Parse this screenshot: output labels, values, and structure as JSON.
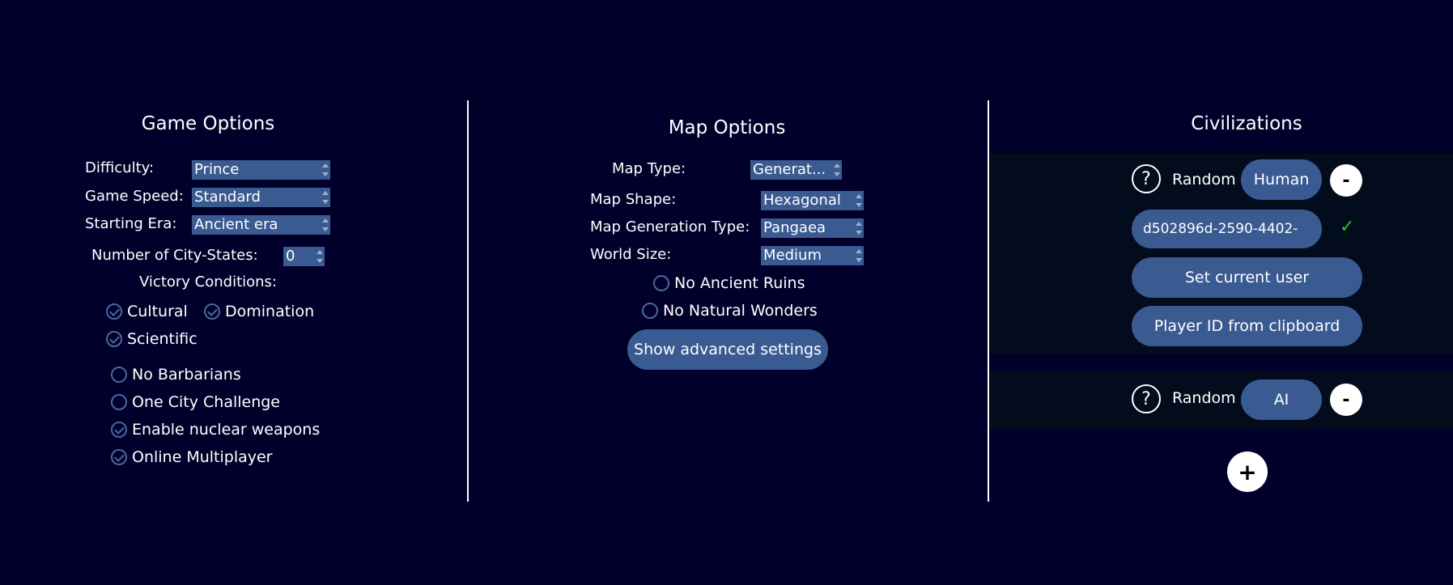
{
  "game_options": {
    "title": "Game Options",
    "difficulty_label": "Difficulty:",
    "difficulty_value": "Prince",
    "game_speed_label": "Game Speed:",
    "game_speed_value": "Standard",
    "starting_era_label": "Starting Era:",
    "starting_era_value": "Ancient era",
    "city_states_label": "Number of City-States:",
    "city_states_value": "0",
    "victory_label": "Victory Conditions:",
    "victory": [
      {
        "label": "Cultural",
        "checked": true
      },
      {
        "label": "Domination",
        "checked": true
      },
      {
        "label": "Scientific",
        "checked": true
      }
    ],
    "toggles": [
      {
        "label": "No Barbarians",
        "checked": false
      },
      {
        "label": "One City Challenge",
        "checked": false
      },
      {
        "label": "Enable nuclear weapons",
        "checked": true
      },
      {
        "label": "Online Multiplayer",
        "checked": true
      }
    ]
  },
  "map_options": {
    "title": "Map Options",
    "map_type_label": "Map Type:",
    "map_type_value": "Generat...",
    "map_shape_label": "Map Shape:",
    "map_shape_value": "Hexagonal",
    "map_gen_label": "Map Generation Type:",
    "map_gen_value": "Pangaea",
    "world_size_label": "World Size:",
    "world_size_value": "Medium",
    "no_ruins_label": "No Ancient Ruins",
    "no_wonders_label": "No Natural Wonders",
    "advanced_label": "Show advanced settings"
  },
  "civilizations": {
    "title": "Civilizations",
    "player1": {
      "question": "?",
      "civ": "Random",
      "type": "Human",
      "remove": "-",
      "player_id": "d502896d-2590-4402-",
      "check": "✓",
      "set_user_label": "Set current user",
      "clipboard_label": "Player ID from clipboard"
    },
    "player2": {
      "question": "?",
      "civ": "Random",
      "type": "AI",
      "remove": "-"
    },
    "add": "+"
  }
}
